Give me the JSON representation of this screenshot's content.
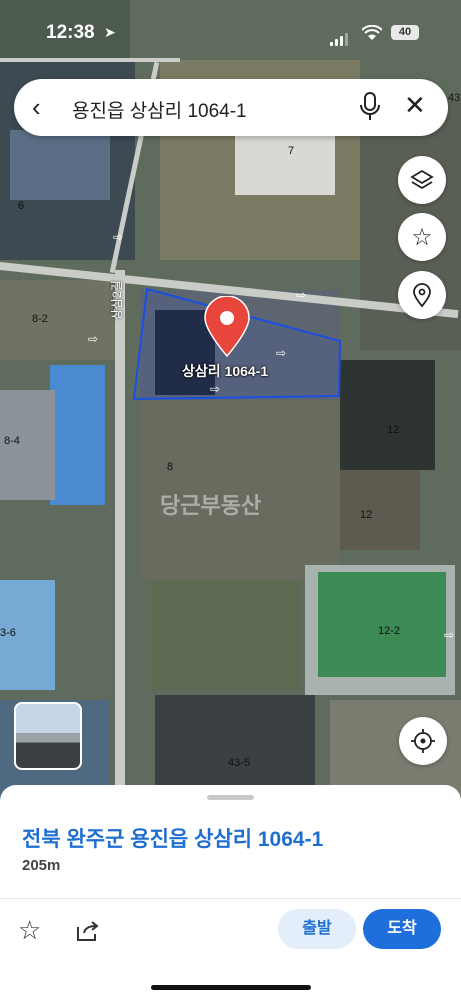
{
  "status_bar": {
    "time": "12:38",
    "battery": "40"
  },
  "search": {
    "query": "용진읍 상삼리 1064-1"
  },
  "map": {
    "pin_label": "상삼리 1064-1",
    "road_label": "상삼2길",
    "watermark": "당근부동산",
    "lot_numbers": [
      {
        "text": "7"
      },
      {
        "text": "6"
      },
      {
        "text": "8-2"
      },
      {
        "text": "8-4"
      },
      {
        "text": "8"
      },
      {
        "text": "12"
      },
      {
        "text": "12"
      },
      {
        "text": "12-2"
      },
      {
        "text": "43-5"
      },
      {
        "text": "3-6"
      },
      {
        "text": "43"
      }
    ]
  },
  "sheet": {
    "address": "전북 완주군 용진읍 상삼리 1064-1",
    "distance": "205m",
    "start_label": "출발",
    "arrive_label": "도착"
  },
  "colors": {
    "accent": "#1e6fdb",
    "boundary": "#1a4fe0",
    "pin": "#e8453c"
  }
}
